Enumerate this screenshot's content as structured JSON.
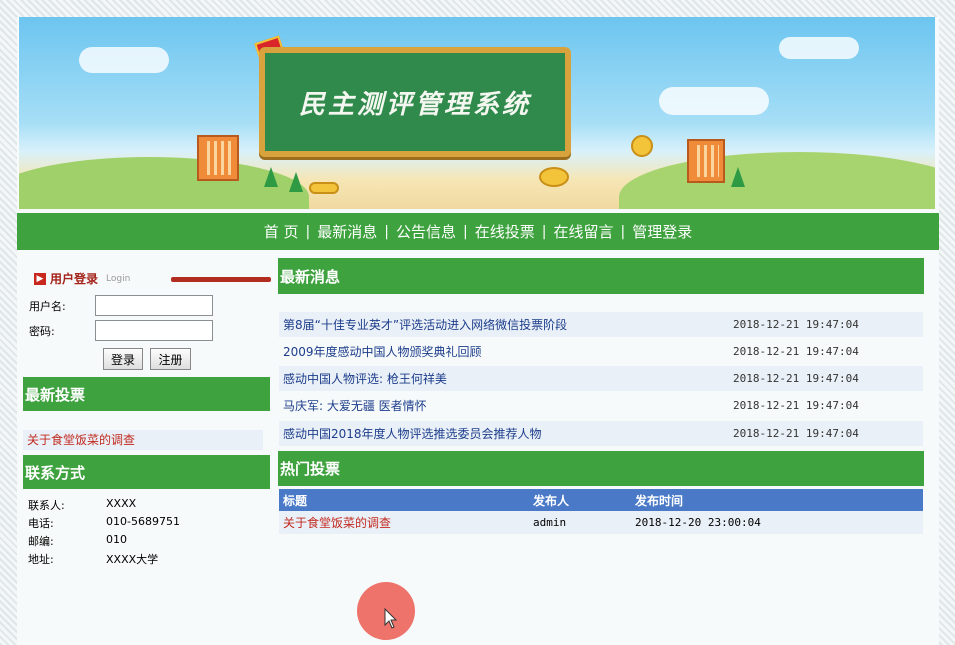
{
  "banner": {
    "title": "民主测评管理系统"
  },
  "nav": {
    "items": [
      "首  页",
      "最新消息",
      "公告信息",
      "在线投票",
      "在线留言",
      "管理登录"
    ],
    "separator": "|"
  },
  "login": {
    "title": "用户登录",
    "subtitle": "Login",
    "username_label": "用户名:",
    "password_label": "密码:",
    "username_value": "",
    "password_value": "",
    "login_button": "登录",
    "register_button": "注册"
  },
  "latest_vote": {
    "heading": "最新投票",
    "items": [
      "关于食堂饭菜的调查"
    ]
  },
  "contact": {
    "heading": "联系方式",
    "rows": [
      {
        "key": "联系人:",
        "value": "XXXX"
      },
      {
        "key": "电话:",
        "value": "010-5689751"
      },
      {
        "key": "邮编:",
        "value": "010"
      },
      {
        "key": "地址:",
        "value": "XXXX大学"
      }
    ]
  },
  "news": {
    "heading": "最新消息",
    "items": [
      {
        "title": "第8届“十佳专业英才”评选活动进入网络微信投票阶段",
        "time": "2018-12-21 19:47:04"
      },
      {
        "title": "2009年度感动中国人物颁奖典礼回顾",
        "time": "2018-12-21 19:47:04"
      },
      {
        "title": "感动中国人物评选: 枪王何祥美",
        "time": "2018-12-21 19:47:04"
      },
      {
        "title": "马庆军: 大爱无疆 医者情怀",
        "time": "2018-12-21 19:47:04"
      },
      {
        "title": "感动中国2018年度人物评选推选委员会推荐人物",
        "time": "2018-12-21 19:47:04"
      }
    ]
  },
  "hot_votes": {
    "heading": "热门投票",
    "columns": [
      "标题",
      "发布人",
      "发布时间"
    ],
    "rows": [
      {
        "title": "关于食堂饭菜的调查",
        "publisher": "admin",
        "time": "2018-12-20 23:00:04"
      }
    ]
  },
  "colors": {
    "nav_green": "#3ea23f",
    "table_header_blue": "#4a79c8",
    "link_red": "#c12a20",
    "link_blue": "#1c3d8c"
  }
}
